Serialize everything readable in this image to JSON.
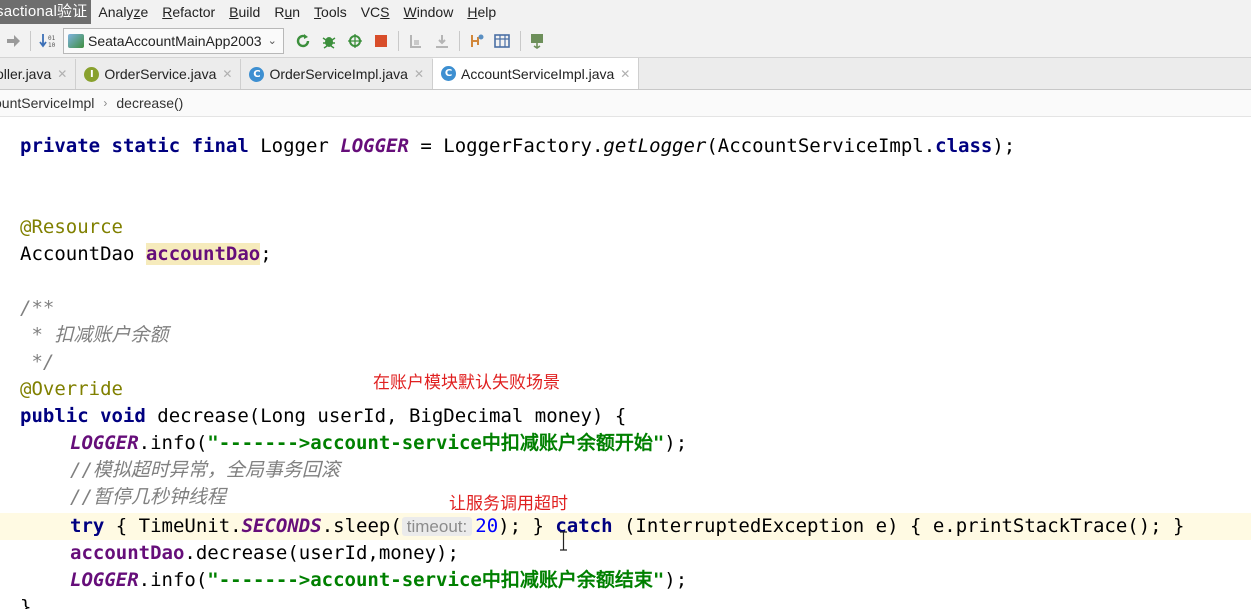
{
  "menu": {
    "title": "sactional验证",
    "items": [
      {
        "pre": "",
        "u": "",
        "post": "Analy",
        "u2": "z",
        "post2": "e"
      },
      {
        "pre": "",
        "u": "R",
        "post": "efactor",
        "u2": "",
        "post2": ""
      },
      {
        "pre": "",
        "u": "B",
        "post": "uild",
        "u2": "",
        "post2": ""
      },
      {
        "pre": "R",
        "u": "u",
        "post": "n",
        "u2": "",
        "post2": ""
      },
      {
        "pre": "",
        "u": "T",
        "post": "ools",
        "u2": "",
        "post2": ""
      },
      {
        "pre": "VC",
        "u": "S",
        "post": "",
        "u2": "",
        "post2": ""
      },
      {
        "pre": "",
        "u": "W",
        "post": "indow",
        "u2": "",
        "post2": ""
      },
      {
        "pre": "",
        "u": "H",
        "post": "elp",
        "u2": "",
        "post2": ""
      }
    ]
  },
  "toolbar": {
    "run_config": "SeataAccountMainApp2003"
  },
  "tabs": [
    {
      "label": "oller.java",
      "icon": "",
      "active": false
    },
    {
      "label": "OrderService.java",
      "icon": "I",
      "active": false
    },
    {
      "label": "OrderServiceImpl.java",
      "icon": "C",
      "active": false
    },
    {
      "label": "AccountServiceImpl.java",
      "icon": "C",
      "active": true
    }
  ],
  "breadcrumb": [
    "ountServiceImpl",
    "decrease()"
  ],
  "code": {
    "l1": {
      "a": "private static final",
      "b": " Logger ",
      "c": "LOGGER",
      "d": " = LoggerFactory.",
      "e": "getLogger",
      "f": "(AccountServiceImpl.",
      "g": "class",
      "h": ");"
    },
    "l2": {
      "a": "@Resource"
    },
    "l3": {
      "a": "AccountDao ",
      "b": "accountDao",
      "c": ";"
    },
    "l4": {
      "a": "/**"
    },
    "l5": {
      "a": " * ",
      "b": "扣减账户余额"
    },
    "l6": {
      "a": " */"
    },
    "l7": {
      "a": "@Override"
    },
    "l8": {
      "a": "public void",
      "b": " decrease(Long userId, BigDecimal money) {"
    },
    "l9": {
      "a": "LOGGER",
      "b": ".info(",
      "c": "\"------->account-service",
      "d": "中扣减账户余额开始",
      "e": "\"",
      "f": ");"
    },
    "l10": {
      "a": "//",
      "b": "模拟超时异常，全局事务回滚"
    },
    "l11": {
      "a": "//",
      "b": "暂停几秒钟线程"
    },
    "l12": {
      "a": "try",
      "b": " { TimeUnit.",
      "c": "SECONDS",
      "d": ".sleep(",
      "hint": "timeout:",
      "e": "20",
      "f": "); } ",
      "g": "catch",
      "h": " (InterruptedException e) { e.printStackTrace(); }"
    },
    "l13": {
      "a": "accountDao",
      "b": ".decrease(userId,money);"
    },
    "l14": {
      "a": "LOGGER",
      "b": ".info(",
      "c": "\"------->account-service",
      "d": "中扣减账户余额结束",
      "e": "\"",
      "f": ");"
    },
    "l15": {
      "a": "}"
    }
  },
  "notes": {
    "account_fail": "在账户模块默认失败场景",
    "timeout": "让服务调用超时"
  }
}
